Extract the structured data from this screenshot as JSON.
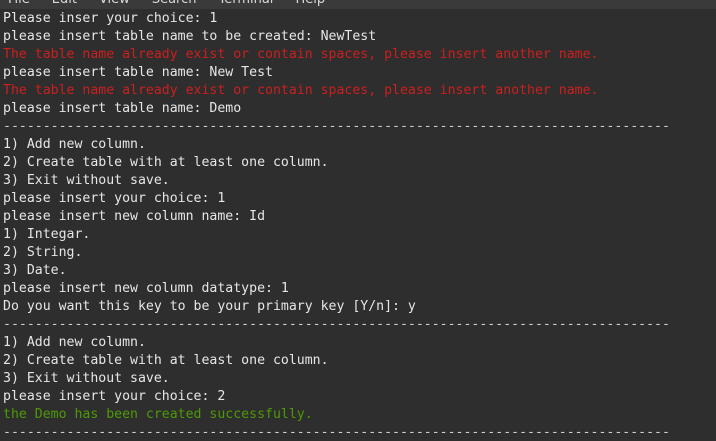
{
  "menu": [
    "File",
    "Edit",
    "View",
    "Search",
    "Terminal",
    "Help"
  ],
  "divider": "------------------------------------------------------------------------------------",
  "lines": [
    {
      "text": "Please inser your choice: 1",
      "kind": "normal"
    },
    {
      "text": "please insert table name to be created: NewTest",
      "kind": "normal"
    },
    {
      "text": "The table name already exist or contain spaces, please insert another name.",
      "kind": "error"
    },
    {
      "text": "please insert table name: New Test",
      "kind": "normal"
    },
    {
      "text": "The table name already exist or contain spaces, please insert another name.",
      "kind": "error"
    },
    {
      "text": "please insert table name: Demo",
      "kind": "normal"
    },
    {
      "text": "",
      "kind": "divider"
    },
    {
      "text": "1) Add new column.",
      "kind": "normal"
    },
    {
      "text": "2) Create table with at least one column.",
      "kind": "normal"
    },
    {
      "text": "3) Exit without save.",
      "kind": "normal"
    },
    {
      "text": "please insert your choice: 1",
      "kind": "normal"
    },
    {
      "text": "please insert new column name: Id",
      "kind": "normal"
    },
    {
      "text": "1) Integar.",
      "kind": "normal"
    },
    {
      "text": "2) String.",
      "kind": "normal"
    },
    {
      "text": "3) Date.",
      "kind": "normal"
    },
    {
      "text": "please insert new column datatype: 1",
      "kind": "normal"
    },
    {
      "text": "Do you want this key to be your primary key [Y/n]: y",
      "kind": "normal"
    },
    {
      "text": "",
      "kind": "divider"
    },
    {
      "text": "1) Add new column.",
      "kind": "normal"
    },
    {
      "text": "2) Create table with at least one column.",
      "kind": "normal"
    },
    {
      "text": "3) Exit without save.",
      "kind": "normal"
    },
    {
      "text": "please insert your choice: 2",
      "kind": "normal"
    },
    {
      "text": "the Demo has been created successfully.",
      "kind": "success"
    },
    {
      "text": "",
      "kind": "divider"
    }
  ],
  "colors": {
    "background": "#2e2e2e",
    "text": "#e6e6e6",
    "error": "#cc1f1f",
    "success": "#4e9a06"
  }
}
